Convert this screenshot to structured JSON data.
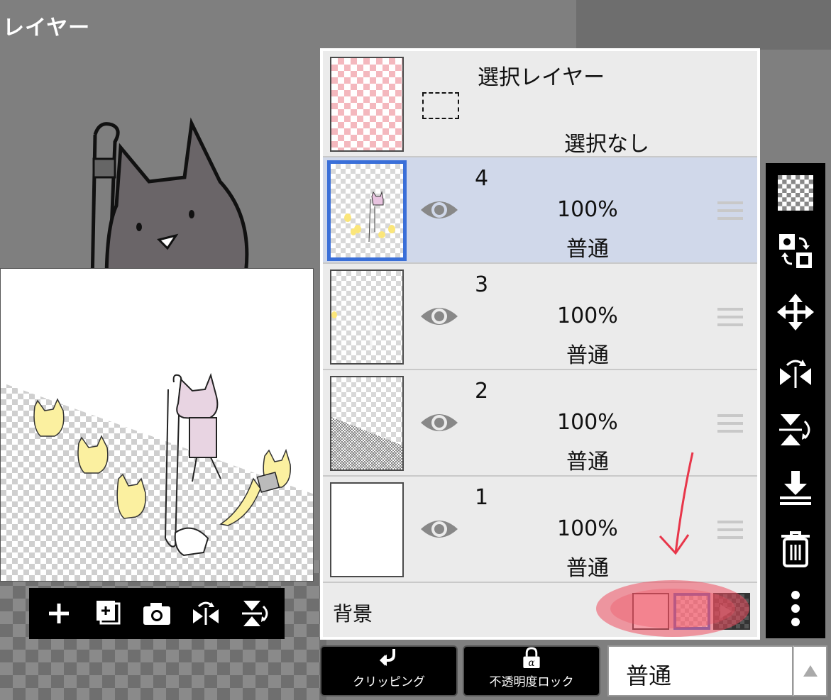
{
  "page": {
    "title": "レイヤー"
  },
  "selection_layer": {
    "title": "選択レイヤー",
    "status": "選択なし"
  },
  "layers": [
    {
      "name": "4",
      "opacity": "100%",
      "mode": "普通"
    },
    {
      "name": "3",
      "opacity": "100%",
      "mode": "普通"
    },
    {
      "name": "2",
      "opacity": "100%",
      "mode": "普通"
    },
    {
      "name": "1",
      "opacity": "100%",
      "mode": "普通"
    }
  ],
  "background": {
    "label": "背景"
  },
  "bottom_bar": {
    "clipping_label": "クリッピング",
    "alpha_lock_label": "不透明度ロック",
    "blend_mode": "普通"
  },
  "colors": {
    "selected_row": "#d0d8ea",
    "accent_blue": "#3a6fd8",
    "annotation_red": "#e8364a"
  },
  "icons": {
    "preview_toolbar": [
      "plus-icon",
      "add-layer-icon",
      "camera-icon",
      "flip-horizontal-icon",
      "flip-vertical-icon"
    ],
    "right_toolbar": [
      "transparency-icon",
      "swap-icon",
      "move-icon",
      "flip-horizontal-icon",
      "flip-vertical-icon",
      "merge-down-icon",
      "trash-icon",
      "more-icon"
    ]
  }
}
